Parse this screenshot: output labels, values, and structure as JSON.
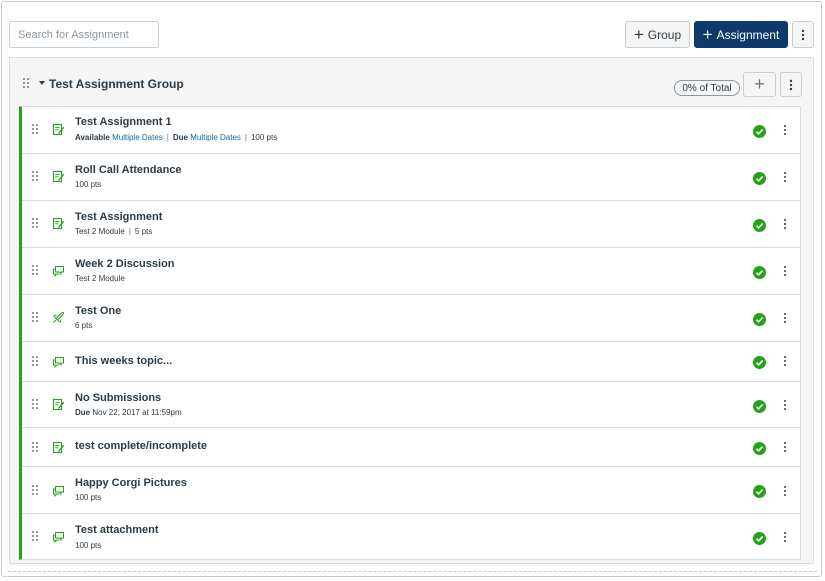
{
  "toolbar": {
    "search_placeholder": "Search for Assignment",
    "group_button_label": "Group",
    "assignment_button_label": "Assignment"
  },
  "assignment_group": {
    "title": "Test Assignment Group",
    "weight_badge": "0% of Total"
  },
  "assignments": [
    {
      "title": "Test Assignment 1",
      "type_icon": "assignment-icon",
      "meta": {
        "available_label": "Available",
        "available_value": "Multiple Dates",
        "due_label": "Due",
        "due_value": "Multiple Dates",
        "points": "100 pts"
      }
    },
    {
      "title": "Roll Call Attendance",
      "type_icon": "assignment-icon",
      "meta_text": "100 pts"
    },
    {
      "title": "Test Assignment",
      "type_icon": "assignment-icon",
      "meta_module": "Test 2 Module",
      "meta_points": "5 pts"
    },
    {
      "title": "Week 2 Discussion",
      "type_icon": "discussion-icon",
      "meta_text": "Test 2 Module"
    },
    {
      "title": "Test One",
      "type_icon": "quiz-icon",
      "meta_text": "6 pts"
    },
    {
      "title": "This weeks topic...",
      "type_icon": "discussion-icon"
    },
    {
      "title": "No Submissions",
      "type_icon": "assignment-icon",
      "meta_due_label": "Due",
      "meta_due_value": "Nov 22, 2017 at 11:59pm"
    },
    {
      "title": "test complete/incomplete",
      "type_icon": "assignment-icon"
    },
    {
      "title": "Happy Corgi Pictures",
      "type_icon": "discussion-icon",
      "meta_text": "100 pts"
    },
    {
      "title": "Test attachment",
      "type_icon": "discussion-icon",
      "meta_text": "100 pts"
    }
  ],
  "colors": {
    "primary_button": "#0e3a6b",
    "published_green": "#23a21a",
    "link_blue": "#0770a3",
    "text": "#2d3b45"
  }
}
